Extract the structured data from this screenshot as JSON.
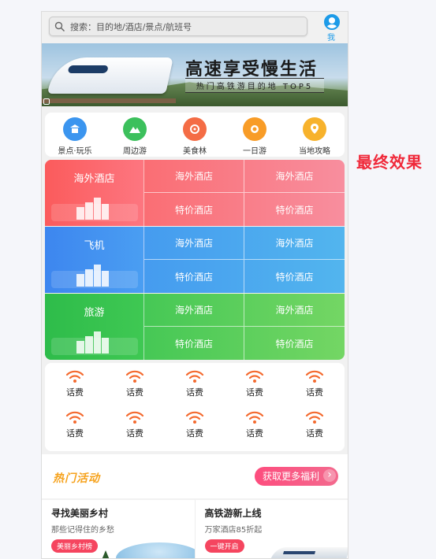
{
  "search": {
    "placeholder": "搜索：目的地/酒店/景点/航班号"
  },
  "me": {
    "label": "我 的"
  },
  "banner": {
    "title": "高速享受慢生活",
    "subtitle": "热门高铁游目的地 TOP5"
  },
  "categories": [
    {
      "label": "景点·玩乐",
      "icon": "attraction-icon",
      "color": "#3b95ef"
    },
    {
      "label": "周边游",
      "icon": "mountain-icon",
      "color": "#3cc05c"
    },
    {
      "label": "美食林",
      "icon": "food-icon",
      "color": "#f46c45"
    },
    {
      "label": "一日游",
      "icon": "badge-icon",
      "color": "#f89c27"
    },
    {
      "label": "当地攻略",
      "icon": "location-icon",
      "color": "#f7b22c"
    }
  ],
  "blocks": [
    {
      "title": "海外酒店",
      "cells": [
        "海外酒店",
        "海外酒店",
        "特价酒店",
        "特价酒店"
      ],
      "color": "#fb5e5f"
    },
    {
      "title": "飞机",
      "cells": [
        "海外酒店",
        "海外酒店",
        "特价酒店",
        "特价酒店"
      ],
      "color": "#3f8ff0"
    },
    {
      "title": "旅游",
      "cells": [
        "海外酒店",
        "海外酒店",
        "特价酒店",
        "特价酒店"
      ],
      "color": "#2fc14e"
    }
  ],
  "fees": [
    "话费",
    "话费",
    "话费",
    "话费",
    "话费",
    "话费",
    "话费",
    "话费",
    "话费",
    "话费"
  ],
  "fee_icon": {
    "name": "wifi-signal-icon",
    "color": "#f46a2f"
  },
  "hot": {
    "title": "热门活动",
    "more": "获取更多福利"
  },
  "cards": [
    {
      "title": "寻找美丽乡村",
      "subtitle": "那些记得住的乡愁",
      "tag": "美丽乡村榜"
    },
    {
      "title": "高铁游新上线",
      "subtitle": "万家酒店85折起",
      "tag": "一键开启"
    }
  ],
  "annotation": "最终效果"
}
